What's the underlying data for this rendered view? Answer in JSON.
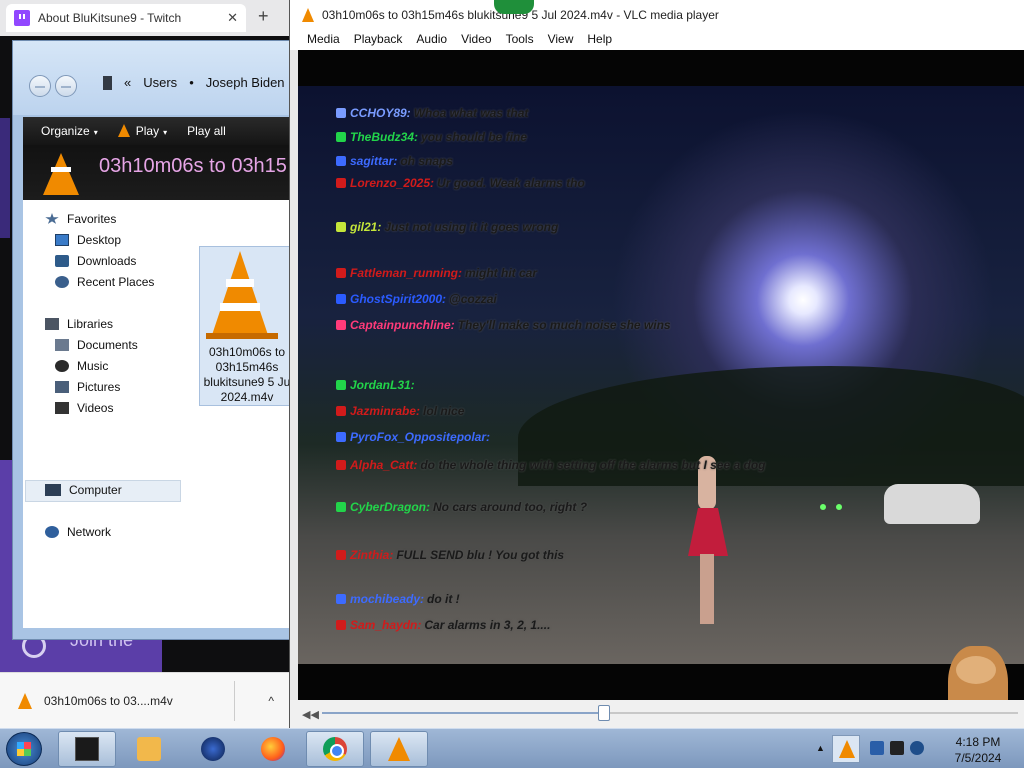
{
  "browser": {
    "tab_title": "About BluKitsune9 - Twitch",
    "tab_close": "✕",
    "new_tab": "+",
    "banner_text": "Join the",
    "download_name": "03h10m06s to 03....m4v",
    "download_chevron": "^"
  },
  "explorer": {
    "breadcrumb": [
      "«",
      "Users",
      "•",
      "Joseph Biden"
    ],
    "toolbar": {
      "organize": "Organize",
      "play": "Play",
      "play_all": "Play all",
      "caret": "▾"
    },
    "header_title": "03h10m06s to 03h15",
    "nav": {
      "favorites": "Favorites",
      "desktop": "Desktop",
      "downloads": "Downloads",
      "recent": "Recent Places",
      "libraries": "Libraries",
      "documents": "Documents",
      "music": "Music",
      "pictures": "Pictures",
      "videos": "Videos",
      "computer": "Computer",
      "network": "Network"
    },
    "file_name": "03h10m06s to 03h15m46s blukitsune9 5 Ju 2024.m4v"
  },
  "vlc": {
    "title": "03h10m06s to 03h15m46s blukitsune9 5 Jul 2024.m4v - VLC media player",
    "menu": [
      "Media",
      "Playback",
      "Audio",
      "Video",
      "Tools",
      "View",
      "Help"
    ],
    "prev_glyph": "◀◀",
    "seek_progress": 0.405,
    "chat": [
      {
        "user": "CCHOY89:",
        "msg": "Whoa what was that",
        "color": "#7a9cff"
      },
      {
        "user": "TheBudz34:",
        "msg": "you should be fine",
        "color": "#22d44a"
      },
      {
        "user": "sagittar:",
        "msg": "oh snaps",
        "color": "#3d6bff"
      },
      {
        "user": "Lorenzo_2025:",
        "msg": "Ur good. Weak alarms tho",
        "color": "#d11b1b"
      },
      {
        "user": "gil21:",
        "msg": "Just not using it it goes wrong",
        "color": "#c5e63a"
      },
      {
        "user": "Fattleman_running:",
        "msg": "might hit car",
        "color": "#d11b1b"
      },
      {
        "user": "GhostSpirit2000:",
        "msg": "@cozzai",
        "color": "#2b5bff"
      },
      {
        "user": "Captainpunchline:",
        "msg": "They'll make so much noise she wins",
        "color": "#ff3b7a"
      },
      {
        "user": "JordanL31:",
        "msg": "",
        "color": "#22d44a"
      },
      {
        "user": "Jazminrabe:",
        "msg": "lol nice",
        "color": "#d11b1b"
      },
      {
        "user": "PyroFox_Oppositepolar:",
        "msg": "",
        "color": "#3d6bff"
      },
      {
        "user": "Alpha_Catt:",
        "msg": "do the whole thing with setting off the alarms but I see a dog",
        "color": "#d11b1b"
      },
      {
        "user": "CyberDragon:",
        "msg": "No cars around too, right ?",
        "color": "#22d44a"
      },
      {
        "user": "Zinthia:",
        "msg": "FULL SEND blu ! You got this",
        "color": "#d11b1b"
      },
      {
        "user": "mochibeady:",
        "msg": "do it !",
        "color": "#3d6bff"
      },
      {
        "user": "Sam_haydn:",
        "msg": "Car alarms in 3, 2, 1....",
        "color": "#d11b1b"
      }
    ]
  },
  "taskbar": {
    "clock_time": "4:18 PM",
    "clock_date": "7/5/2024",
    "tray_up": "▲"
  },
  "colors": {
    "vlc_orange": "#f08a00",
    "twitch_purple": "#9147ff",
    "taskbar_blue": "#8aa6ca"
  }
}
